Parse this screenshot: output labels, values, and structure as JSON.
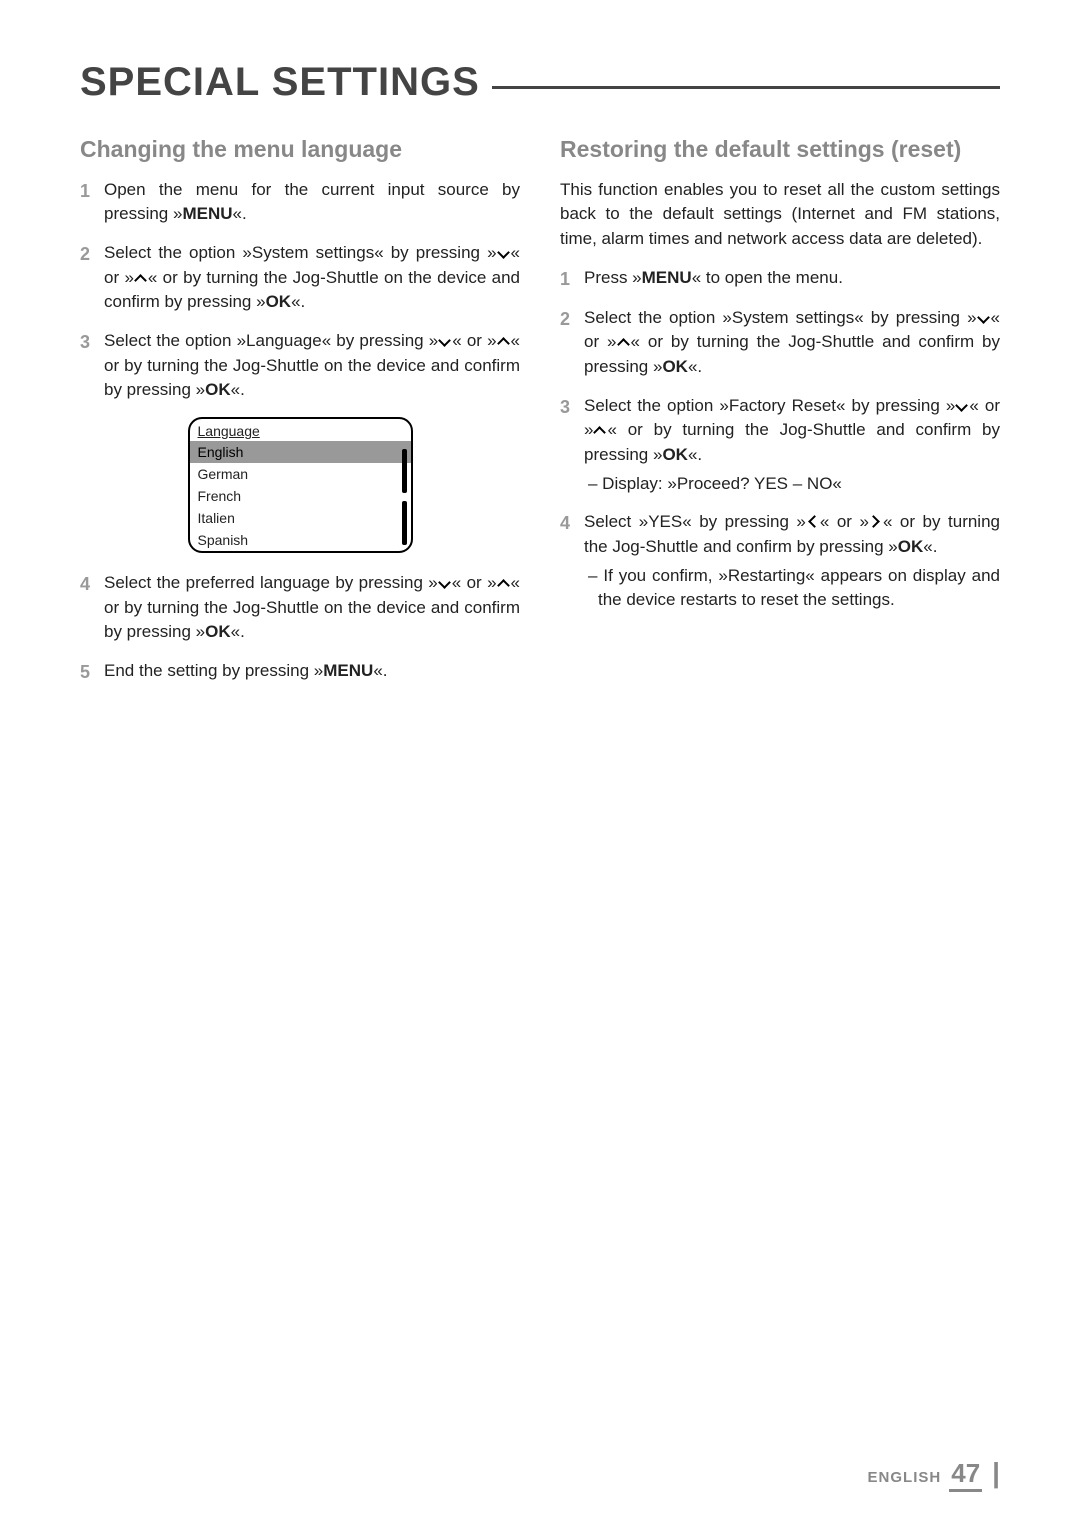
{
  "page_title": "SPECIAL SETTINGS",
  "left": {
    "heading": "Changing the menu language",
    "step1_num": "1",
    "step1": "Open the menu for the current input source by pressing »",
    "step1_btn": "MENU",
    "step1_end": "«.",
    "step2_num": "2",
    "step2_a": "Select the option »System settings« by pressing »",
    "step2_b": "« or »",
    "step2_c": "« or by turning the Jog-Shuttle on the device and confirm by pressing »",
    "step2_btn": "OK",
    "step2_end": "«.",
    "step3_num": "3",
    "step3_a": "Select the option »Language« by pressing »",
    "step3_b": "« or »",
    "step3_c": "« or by turning the Jog-Shuttle on the device and confirm by pressing »",
    "step3_btn": "OK",
    "step3_end": "«.",
    "menu": {
      "header": "Language",
      "items": [
        "English",
        "German",
        "French",
        "Italien",
        "Spanish"
      ],
      "selected_index": 0
    },
    "step4_num": "4",
    "step4_a": "Select the preferred language by pressing »",
    "step4_b": "« or »",
    "step4_c": "« or by turning the Jog-Shuttle on the device and confirm by pressing »",
    "step4_btn": "OK",
    "step4_end": "«.",
    "step5_num": "5",
    "step5_a": "End the setting by pressing »",
    "step5_btn": "MENU",
    "step5_end": "«."
  },
  "right": {
    "heading": "Restoring the default settings (reset)",
    "intro": "This function enables you to reset all the custom settings back to the default settings (Internet and FM stations, time, alarm times and network access data are deleted).",
    "step1_num": "1",
    "step1_a": "Press »",
    "step1_btn": "MENU",
    "step1_b": "« to open the menu.",
    "step2_num": "2",
    "step2_a": "Select the option »System settings« by pressing »",
    "step2_b": "« or »",
    "step2_c": "« or by turning the Jog-Shuttle and confirm by pressing »",
    "step2_btn": "OK",
    "step2_end": "«.",
    "step3_num": "3",
    "step3_a": "Select the option »Factory Reset« by pressing »",
    "step3_b": "« or »",
    "step3_c": "« or by turning the Jog-Shuttle and confirm by pressing »",
    "step3_btn": "OK",
    "step3_end": "«.",
    "step3_sub": "– Display: »Proceed? YES – NO«",
    "step4_num": "4",
    "step4_a": "Select »YES« by pressing »",
    "step4_b": "« or »",
    "step4_c": "« or by turning the Jog-Shuttle and confirm by pressing »",
    "step4_btn": "OK",
    "step4_end": "«.",
    "step4_sub": "– If you confirm, »Restarting« appears on display and the device restarts to reset the settings."
  },
  "footer": {
    "lang": "ENGLISH",
    "page": "47"
  }
}
